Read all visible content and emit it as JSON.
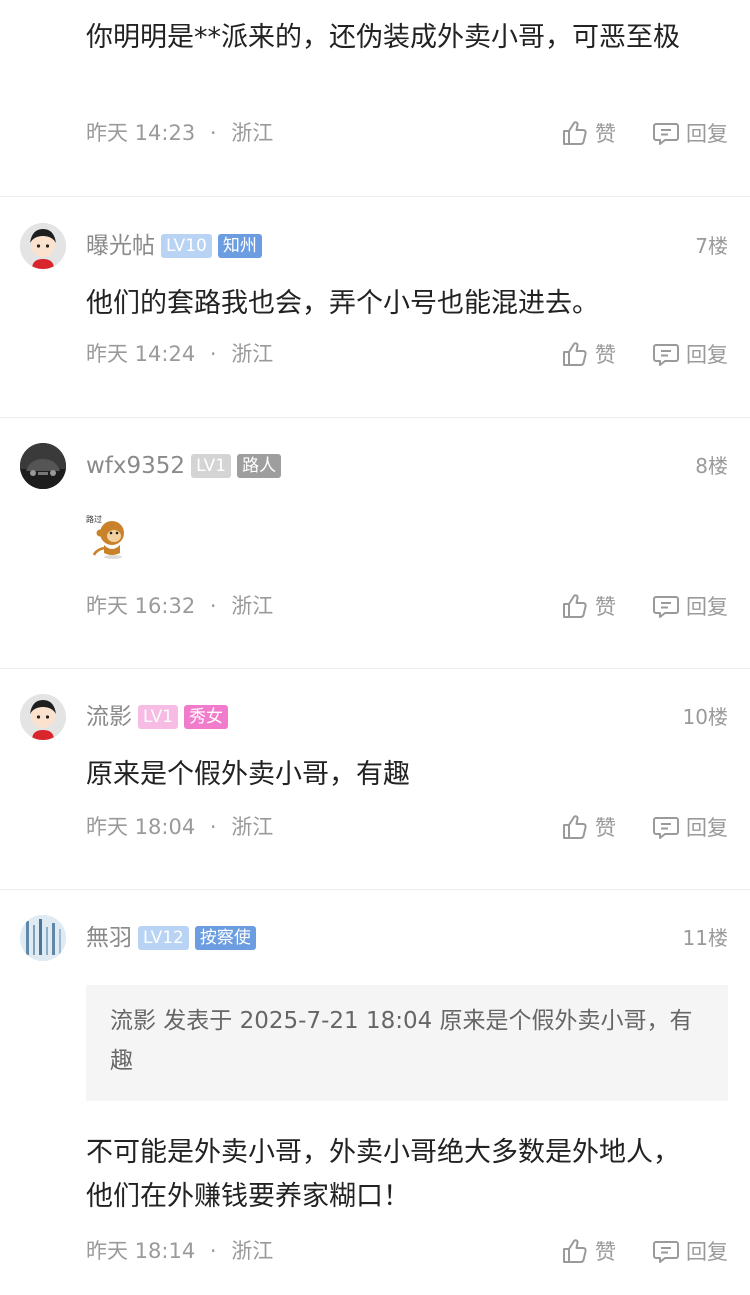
{
  "comments": [
    {
      "content": "你明明是**派来的，还伪装成外卖小哥，可恶至极",
      "time": "昨天 14:23",
      "location": "浙江",
      "like_label": "赞",
      "reply_label": "回复"
    },
    {
      "username": "曝光帖",
      "level": "LV10",
      "title_tag": "知州",
      "floor": "7楼",
      "content": "他们的套路我也会，弄个小号也能混进去。",
      "time": "昨天 14:24",
      "location": "浙江",
      "like_label": "赞",
      "reply_label": "回复"
    },
    {
      "username": "wfx9352",
      "level": "LV1",
      "title_tag": "路人",
      "floor": "8楼",
      "sticker_text": "路过",
      "time": "昨天 16:32",
      "location": "浙江",
      "like_label": "赞",
      "reply_label": "回复"
    },
    {
      "username": "流影",
      "level": "LV1",
      "title_tag": "秀女",
      "floor": "10楼",
      "content": "原来是个假外卖小哥，有趣",
      "time": "昨天 18:04",
      "location": "浙江",
      "like_label": "赞",
      "reply_label": "回复"
    },
    {
      "username": "無羽",
      "level": "LV12",
      "title_tag": "按察使",
      "floor": "11楼",
      "quote": "流影  发表于  2025-7-21 18:04  原来是个假外卖小哥，有趣",
      "content": "不可能是外卖小哥，外卖小哥绝大多数是外地人，他们在外赚钱要养家糊口！",
      "time": "昨天 18:14",
      "location": "浙江",
      "like_label": "赞",
      "reply_label": "回复"
    }
  ],
  "separator": "·",
  "colors": {
    "meta_grey": "#9a9a9a",
    "badge_blue": "#6b9de0",
    "badge_pink": "#f17ccc",
    "badge_grey": "#9e9e9e"
  }
}
